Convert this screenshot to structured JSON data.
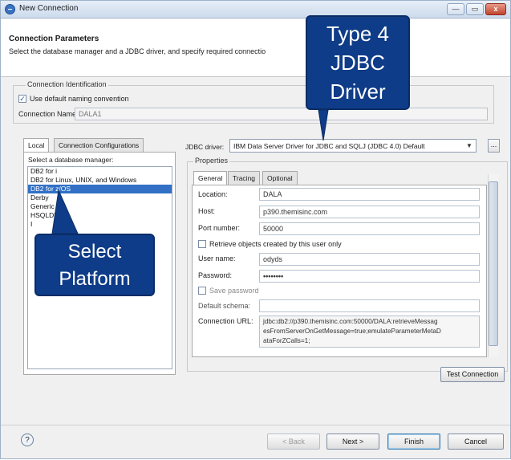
{
  "window": {
    "title": "New Connection",
    "buttons": {
      "minimize": "—",
      "maximize": "▭",
      "close": "x"
    }
  },
  "header": {
    "title": "Connection Parameters",
    "description": "Select the database manager and a JDBC driver, and specify required connectio"
  },
  "connection_identification": {
    "group_label": "Connection Identification",
    "use_default_naming_label": "Use default naming convention",
    "use_default_naming_checked": true,
    "connection_name_label": "Connection Name:",
    "connection_name_value": "DALA1"
  },
  "tabs_left": [
    {
      "label": "Local",
      "active": true
    },
    {
      "label": "Connection Configurations",
      "active": false
    }
  ],
  "db_manager": {
    "label": "Select a database manager:",
    "items": [
      {
        "label": "DB2 for i",
        "selected": false
      },
      {
        "label": "DB2 for Linux, UNIX, and Windows",
        "selected": false
      },
      {
        "label": "DB2 for z/OS",
        "selected": true
      },
      {
        "label": "Derby",
        "selected": false
      },
      {
        "label": "Generic",
        "selected": false
      },
      {
        "label": "HSQLDB",
        "selected": false
      },
      {
        "label": "I",
        "selected": false
      }
    ]
  },
  "jdbc_driver": {
    "label": "JDBC driver:",
    "value": "IBM Data Server Driver for JDBC and SQLJ (JDBC 4.0) Default",
    "browse": "..."
  },
  "properties": {
    "group_label": "Properties",
    "tabs": [
      {
        "label": "General",
        "active": true
      },
      {
        "label": "Tracing",
        "active": false
      },
      {
        "label": "Optional",
        "active": false
      }
    ],
    "location_label": "Location:",
    "location_value": "DALA",
    "host_label": "Host:",
    "host_value": "p390.themisinc.com",
    "port_label": "Port number:",
    "port_value": "50000",
    "retrieve_objects_label": "Retrieve objects created by this user only",
    "user_name_label": "User name:",
    "user_name_value": "odyds",
    "password_label": "Password:",
    "password_value": "••••••••",
    "save_password_label": "Save password",
    "default_schema_label": "Default schema:",
    "default_schema_value": "",
    "connection_url_label": "Connection URL:",
    "connection_url_lines": [
      "jdbc:db2://p390.themisinc.com:50000/DALA:retrieveMessag",
      "esFromServerOnGetMessage=true;emulateParameterMetaD",
      "ataForZCalls=1;"
    ]
  },
  "test_connection_label": "Test Connection",
  "footer": {
    "help_icon": "?",
    "back_label": "< Back",
    "next_label": "Next >",
    "finish_label": "Finish",
    "cancel_label": "Cancel"
  },
  "callouts": {
    "driver_lines": [
      "Type 4",
      "JDBC",
      "Driver"
    ],
    "platform_lines": [
      "Select",
      "Platform"
    ]
  },
  "colors": {
    "callout_bg": "#0f3c88",
    "selection": "#3170c5"
  }
}
